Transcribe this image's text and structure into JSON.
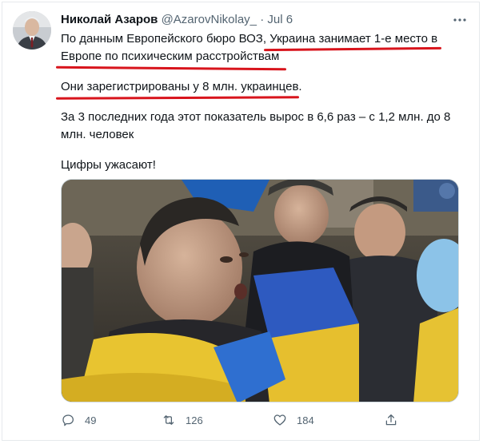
{
  "tweet": {
    "author_name": "Николай Азаров",
    "handle": "@AzarovNikolay_",
    "separator": "·",
    "date": "Jul 6",
    "line1_part1": "По данным Европейского бюро ВОЗ, ",
    "line1_part2": "Украина занимает 1-е место в",
    "line2": "Европе по психическим расстройствам",
    "para2": "Они зарегистрированы у 8 млн. украинцев.",
    "para3": "За 3 последних года этот показатель вырос в 6,6 раз – с 1,2 млн. до 8 млн. человек",
    "para4": "Цифры ужасают!"
  },
  "actions": {
    "replies": "49",
    "retweets": "126",
    "likes": "184"
  },
  "icons": {
    "more": "more-icon",
    "reply": "reply-icon",
    "retweet": "retweet-icon",
    "like": "heart-icon",
    "share": "share-icon"
  },
  "colors": {
    "highlight_underline": "#d8141c",
    "secondary_text": "#536471"
  }
}
